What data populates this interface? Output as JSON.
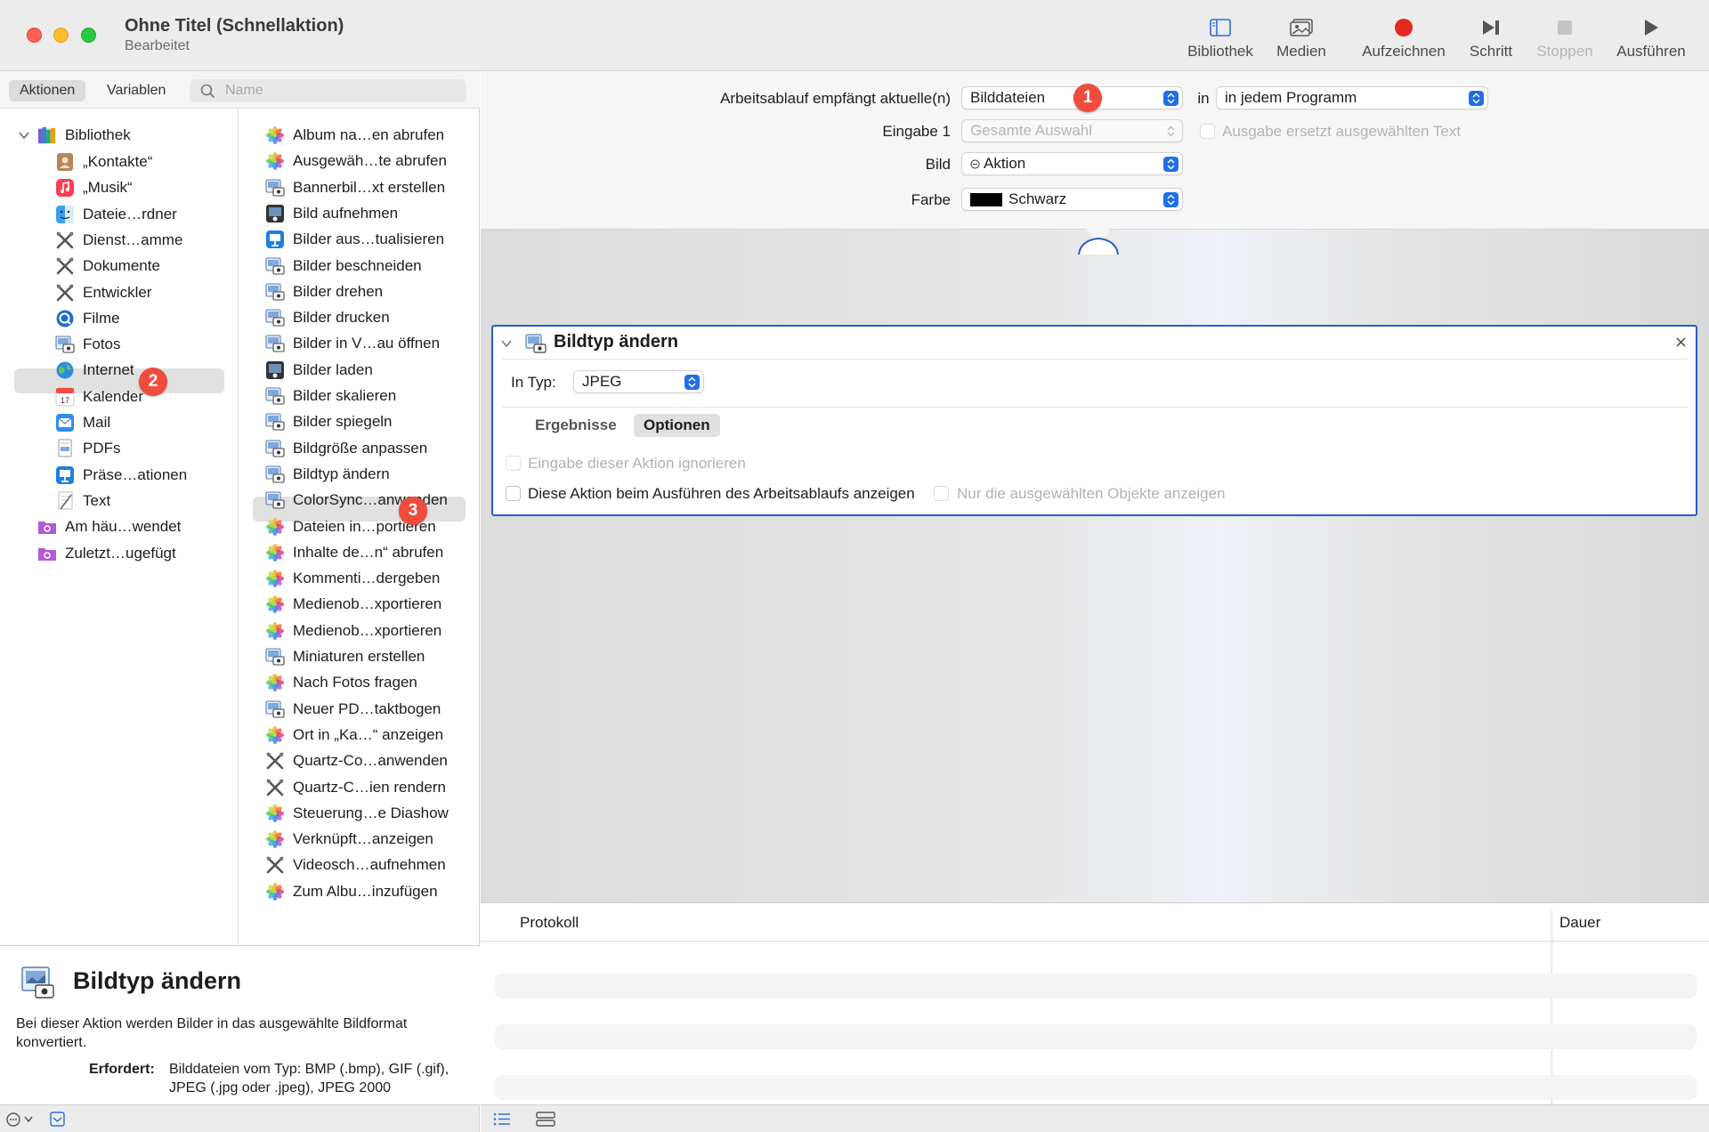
{
  "window": {
    "title": "Ohne Titel (Schnellaktion)",
    "subtitle": "Bearbeitet"
  },
  "toolbar": {
    "library": "Bibliothek",
    "media": "Medien",
    "record": "Aufzeichnen",
    "step": "Schritt",
    "stop": "Stoppen",
    "run": "Ausführen"
  },
  "left_tabs": {
    "actions": "Aktionen",
    "variables": "Variablen",
    "search_placeholder": "Name"
  },
  "library": {
    "root": "Bibliothek",
    "items": [
      "„Kontakte“",
      "„Musik“",
      "Dateie…rdner",
      "Dienst…amme",
      "Dokumente",
      "Entwickler",
      "Filme",
      "Fotos",
      "Internet",
      "Kalender",
      "Mail",
      "PDFs",
      "Präse…ationen",
      "Text"
    ],
    "smart": [
      "Am häu…wendet",
      "Zuletzt…ugefügt"
    ],
    "selected": "Fotos"
  },
  "actions": {
    "items": [
      "Album na…en abrufen",
      "Ausgewäh…te abrufen",
      "Bannerbil…xt erstellen",
      "Bild aufnehmen",
      "Bilder aus…tualisieren",
      "Bilder beschneiden",
      "Bilder drehen",
      "Bilder drucken",
      "Bilder in V…au öffnen",
      "Bilder laden",
      "Bilder skalieren",
      "Bilder spiegeln",
      "Bildgröße anpassen",
      "Bildtyp ändern",
      "ColorSync…anwenden",
      "Dateien in…portieren",
      "Inhalte de…n“ abrufen",
      "Kommenti…dergeben",
      "Medienob…xportieren",
      "Medienob…xportieren",
      "Miniaturen erstellen",
      "Nach Fotos fragen",
      "Neuer PD…taktbogen",
      "Ort in „Ka…“ anzeigen",
      "Quartz-Co…anwenden",
      "Quartz-C…ien rendern",
      "Steuerung…e Diashow",
      "Verknüpft…anzeigen",
      "Videosch…aufnehmen",
      "Zum Albu…inzufügen"
    ],
    "icons": [
      "photos",
      "photos",
      "preview",
      "camera",
      "keynote",
      "preview",
      "preview",
      "preview",
      "preview",
      "camera",
      "preview",
      "preview",
      "preview",
      "preview",
      "preview",
      "photos",
      "photos",
      "photos",
      "photos",
      "photos",
      "preview",
      "photos",
      "preview",
      "photos",
      "tools",
      "tools",
      "photos",
      "photos",
      "tools",
      "photos"
    ],
    "selected": "Bildtyp ändern"
  },
  "badges": [
    "1",
    "2",
    "3"
  ],
  "description": {
    "title": "Bildtyp ändern",
    "text": "Bei dieser Aktion werden Bilder in das ausgewählte Bildformat konvertiert.",
    "requires_label": "Erfordert:",
    "requires_text": "Bilddateien vom Typ: BMP (.bmp), GIF (.gif), JPEG (.jpg oder .jpeg), JPEG 2000"
  },
  "workflow": {
    "receives_label": "Arbeitsablauf empfängt aktuelle(n)",
    "receives_value": "Bilddateien",
    "in_label": "in",
    "in_value": "in jedem Programm",
    "input_label": "Eingabe 1",
    "input_value": "Gesamte Auswahl",
    "replaces_label": "Ausgabe ersetzt ausgewählten Text",
    "image_label": "Bild",
    "image_value": "Aktion",
    "color_label": "Farbe",
    "color_value": "Schwarz",
    "color_swatch": "#000000"
  },
  "action_card": {
    "title": "Bildtyp ändern",
    "type_label": "In Typ:",
    "type_value": "JPEG",
    "tab_results": "Ergebnisse",
    "tab_options": "Optionen",
    "ignore_input": "Eingabe dieser Aktion ignorieren",
    "show_when_run": "Diese Aktion beim Ausführen des Arbeitsablaufs anzeigen",
    "only_selected": "Nur die ausgewählten Objekte anzeigen"
  },
  "log": {
    "col_protocol": "Protokoll",
    "col_duration": "Dauer"
  },
  "colors": {
    "accent": "#1f6fe6",
    "badge": "#ef4c3d",
    "record": "#e5281c",
    "card_border": "#2a5fc4"
  }
}
